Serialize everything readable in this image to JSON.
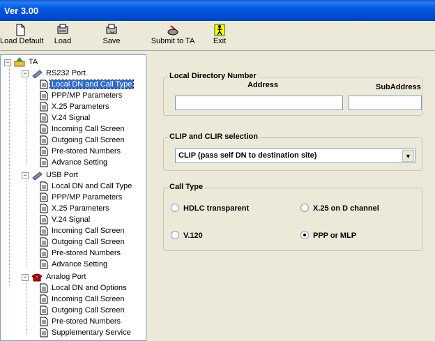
{
  "window": {
    "title": "Ver 3.00"
  },
  "toolbar": {
    "buttons": [
      {
        "label": "Load Default",
        "icon": "new-document-icon"
      },
      {
        "label": "Load",
        "icon": "load-icon"
      },
      {
        "label": "Save",
        "icon": "save-icon"
      },
      {
        "label": "Submit to TA",
        "icon": "submit-icon"
      },
      {
        "label": "Exit",
        "icon": "exit-icon"
      }
    ]
  },
  "tree": {
    "root": "TA",
    "rs232": {
      "label": "RS232 Port",
      "items": [
        "Local DN and Call Type",
        "PPP/MP Parameters",
        "X.25 Parameters",
        "V.24 Signal",
        "Incoming Call Screen",
        "Outgoing Call Screen",
        "Pre-stored Numbers",
        "Advance Setting"
      ]
    },
    "usb": {
      "label": "USB Port",
      "items": [
        "Local DN and Call Type",
        "PPP/MP Parameters",
        "X.25 Parameters",
        "V.24 Signal",
        "Incoming Call Screen",
        "Outgoing Call Screen",
        "Pre-stored Numbers",
        "Advance Setting"
      ]
    },
    "analog": {
      "label": "Analog Port",
      "items": [
        "Local DN and Options",
        "Incoming Call Screen",
        "Outgoing Call Screen",
        "Pre-stored Numbers",
        "Supplementary Service"
      ]
    },
    "selected": "Local DN and Call Type"
  },
  "panel": {
    "ldn": {
      "title": "Local Directory Number",
      "address_label": "Address",
      "subaddress_label": "SubAddress",
      "address_value": "",
      "subaddress_value": ""
    },
    "clip": {
      "title": "CLIP and CLIR selection",
      "selected": "CLIP (pass self DN to destination site)"
    },
    "calltype": {
      "title": "Call Type",
      "options": [
        {
          "label": "HDLC transparent",
          "checked": false
        },
        {
          "label": "X.25 on D channel",
          "checked": false
        },
        {
          "label": "V.120",
          "checked": false
        },
        {
          "label": "PPP or MLP",
          "checked": true
        }
      ]
    }
  }
}
